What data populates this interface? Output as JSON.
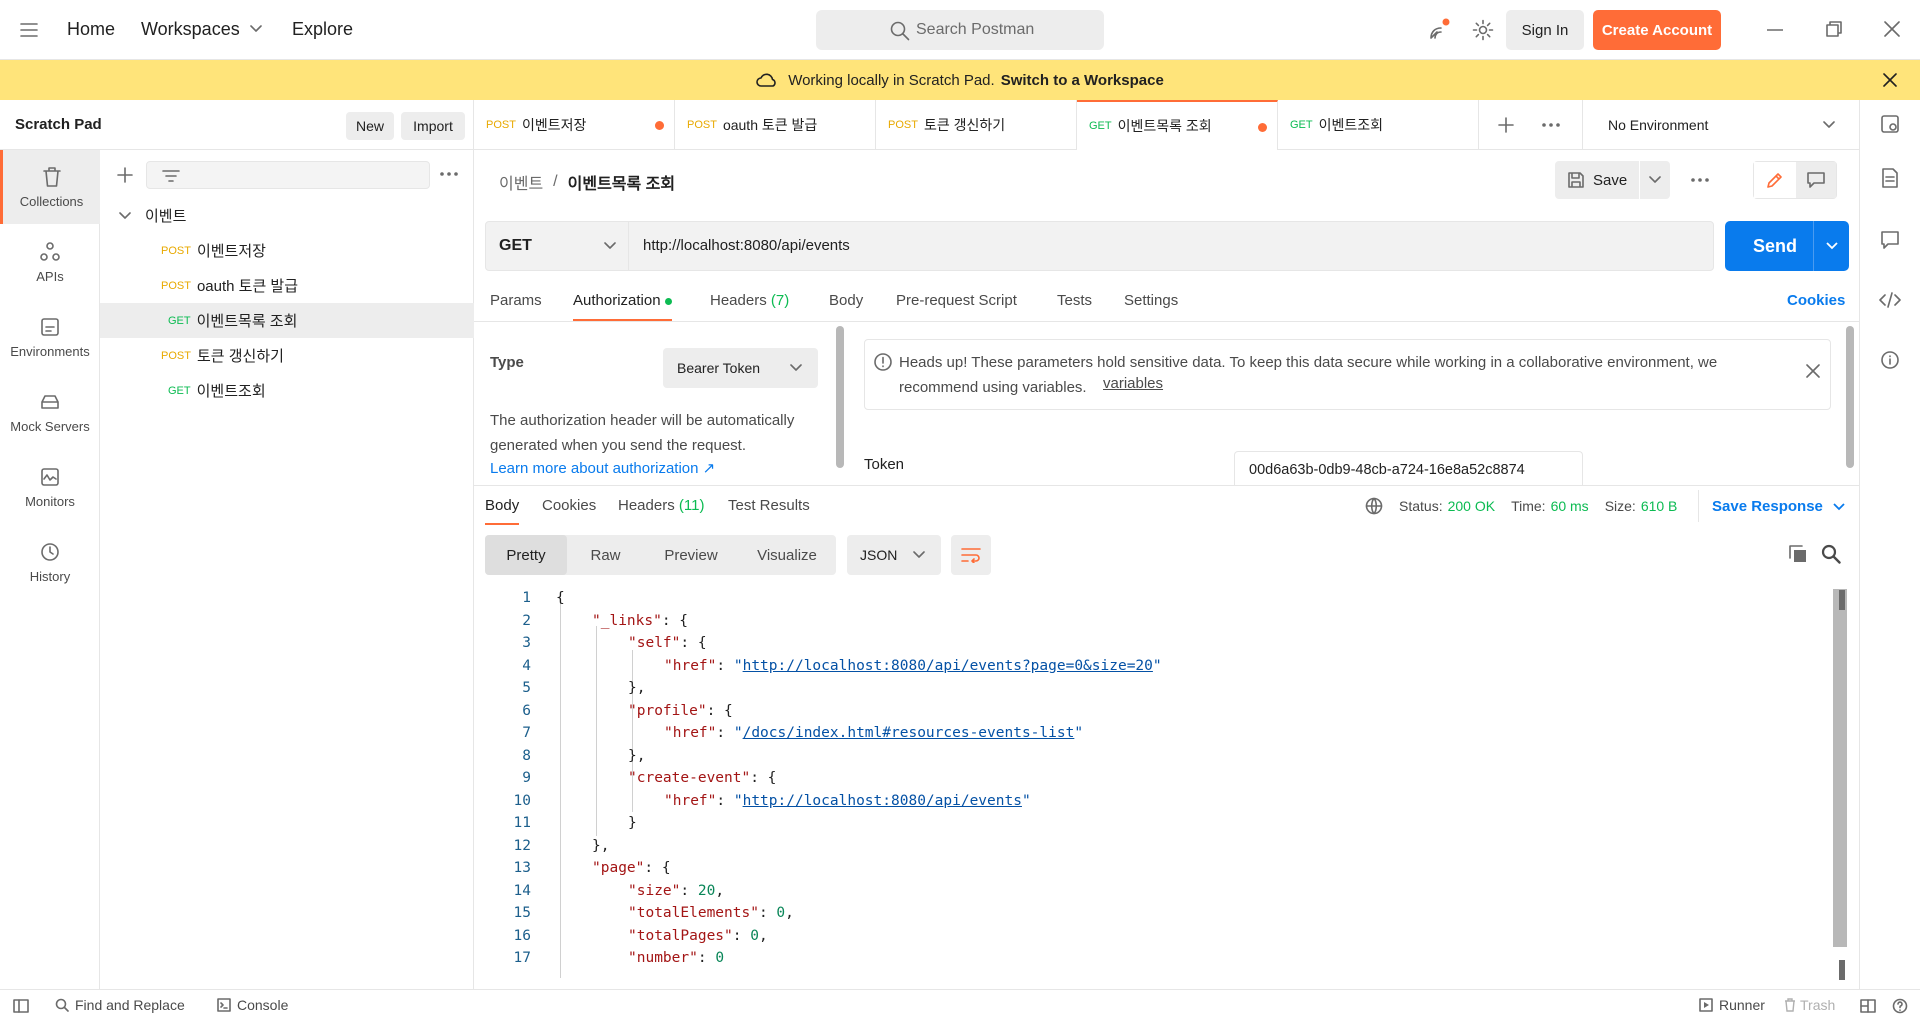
{
  "topbar": {
    "nav": [
      "Home",
      "Workspaces",
      "Explore"
    ],
    "search_placeholder": "Search Postman",
    "sign_in": "Sign In",
    "create_account": "Create Account"
  },
  "banner": {
    "text": "Working locally in Scratch Pad.",
    "link": "Switch to a Workspace"
  },
  "scratchpad": {
    "title": "Scratch Pad",
    "new": "New",
    "import": "Import"
  },
  "leftnav": [
    "Collections",
    "APIs",
    "Environments",
    "Mock Servers",
    "Monitors",
    "History"
  ],
  "collection": {
    "name": "이벤트",
    "items": [
      {
        "method": "POST",
        "name": "이벤트저장"
      },
      {
        "method": "POST",
        "name": "oauth 토큰 발급"
      },
      {
        "method": "GET",
        "name": "이벤트목록 조회"
      },
      {
        "method": "POST",
        "name": "토큰 갱신하기"
      },
      {
        "method": "GET",
        "name": "이벤트조회"
      }
    ]
  },
  "tabs": [
    {
      "method": "POST",
      "name": "이벤트저장"
    },
    {
      "method": "POST",
      "name": "oauth 토큰 발급"
    },
    {
      "method": "POST",
      "name": "토큰 갱신하기"
    },
    {
      "method": "GET",
      "name": "이벤트목록 조회"
    },
    {
      "method": "GET",
      "name": "이벤트조회"
    }
  ],
  "environment": "No Environment",
  "breadcrumb": {
    "parent": "이벤트",
    "sep": "/",
    "current": "이벤트목록 조회"
  },
  "save": "Save",
  "request": {
    "method": "GET",
    "url": "http://localhost:8080/api/events",
    "send": "Send"
  },
  "request_tabs": {
    "params": "Params",
    "authorization": "Authorization",
    "headers": "Headers",
    "headers_count": "(7)",
    "body": "Body",
    "prerequest": "Pre-request Script",
    "tests": "Tests",
    "settings": "Settings",
    "cookies": "Cookies"
  },
  "auth": {
    "type_label": "Type",
    "type_value": "Bearer Token",
    "desc": "The authorization header will be automatically generated when you send the request.",
    "learn": "Learn more about authorization ↗",
    "headsup": "Heads up! These parameters hold sensitive data. To keep this data secure while working in a collaborative environment, we recommend using variables.",
    "variables_link": "variables",
    "token_label": "Token",
    "token_value": "00d6a63b-0db9-48cb-a724-16e8a52c8874"
  },
  "response": {
    "tabs": [
      "Body",
      "Cookies"
    ],
    "headers": "Headers",
    "headers_count": "(11)",
    "test_results": "Test Results",
    "status_label": "Status:",
    "status_value": "200 OK",
    "time_label": "Time:",
    "time_value": "60 ms",
    "size_label": "Size:",
    "size_value": "610 B",
    "save_response": "Save Response",
    "views": [
      "Pretty",
      "Raw",
      "Preview",
      "Visualize"
    ],
    "format": "JSON"
  },
  "code_lines": [
    {
      "n": "1",
      "indent": 0,
      "parts": [
        [
          "p",
          "{"
        ]
      ]
    },
    {
      "n": "2",
      "indent": 1,
      "parts": [
        [
          "k",
          "\"_links\""
        ],
        [
          "p",
          ": {"
        ]
      ]
    },
    {
      "n": "3",
      "indent": 2,
      "parts": [
        [
          "k",
          "\"self\""
        ],
        [
          "p",
          ": {"
        ]
      ]
    },
    {
      "n": "4",
      "indent": 3,
      "parts": [
        [
          "k",
          "\"href\""
        ],
        [
          "p",
          ": "
        ],
        [
          "s",
          "\""
        ],
        [
          "lnk",
          "http://localhost:8080/api/events?page=0&size=20"
        ],
        [
          "s",
          "\""
        ]
      ]
    },
    {
      "n": "5",
      "indent": 2,
      "parts": [
        [
          "p",
          "},"
        ]
      ]
    },
    {
      "n": "6",
      "indent": 2,
      "parts": [
        [
          "k",
          "\"profile\""
        ],
        [
          "p",
          ": {"
        ]
      ]
    },
    {
      "n": "7",
      "indent": 3,
      "parts": [
        [
          "k",
          "\"href\""
        ],
        [
          "p",
          ": "
        ],
        [
          "s",
          "\""
        ],
        [
          "lnk",
          "/docs/index.html#resources-events-list"
        ],
        [
          "s",
          "\""
        ]
      ]
    },
    {
      "n": "8",
      "indent": 2,
      "parts": [
        [
          "p",
          "},"
        ]
      ]
    },
    {
      "n": "9",
      "indent": 2,
      "parts": [
        [
          "k",
          "\"create-event\""
        ],
        [
          "p",
          ": {"
        ]
      ]
    },
    {
      "n": "10",
      "indent": 3,
      "parts": [
        [
          "k",
          "\"href\""
        ],
        [
          "p",
          ": "
        ],
        [
          "s",
          "\""
        ],
        [
          "lnk",
          "http://localhost:8080/api/events"
        ],
        [
          "s",
          "\""
        ]
      ]
    },
    {
      "n": "11",
      "indent": 2,
      "parts": [
        [
          "p",
          "}"
        ]
      ]
    },
    {
      "n": "12",
      "indent": 1,
      "parts": [
        [
          "p",
          "},"
        ]
      ]
    },
    {
      "n": "13",
      "indent": 1,
      "parts": [
        [
          "k",
          "\"page\""
        ],
        [
          "p",
          ": {"
        ]
      ]
    },
    {
      "n": "14",
      "indent": 2,
      "parts": [
        [
          "k",
          "\"size\""
        ],
        [
          "p",
          ": "
        ],
        [
          "n",
          "20"
        ],
        [
          "p",
          ","
        ]
      ]
    },
    {
      "n": "15",
      "indent": 2,
      "parts": [
        [
          "k",
          "\"totalElements\""
        ],
        [
          "p",
          ": "
        ],
        [
          "n",
          "0"
        ],
        [
          "p",
          ","
        ]
      ]
    },
    {
      "n": "16",
      "indent": 2,
      "parts": [
        [
          "k",
          "\"totalPages\""
        ],
        [
          "p",
          ": "
        ],
        [
          "n",
          "0"
        ],
        [
          "p",
          ","
        ]
      ]
    },
    {
      "n": "17",
      "indent": 2,
      "parts": [
        [
          "k",
          "\"number\""
        ],
        [
          "p",
          ": "
        ],
        [
          "n",
          "0"
        ]
      ]
    }
  ],
  "statusbar": {
    "find": "Find and Replace",
    "console": "Console",
    "runner": "Runner",
    "trash": "Trash"
  }
}
